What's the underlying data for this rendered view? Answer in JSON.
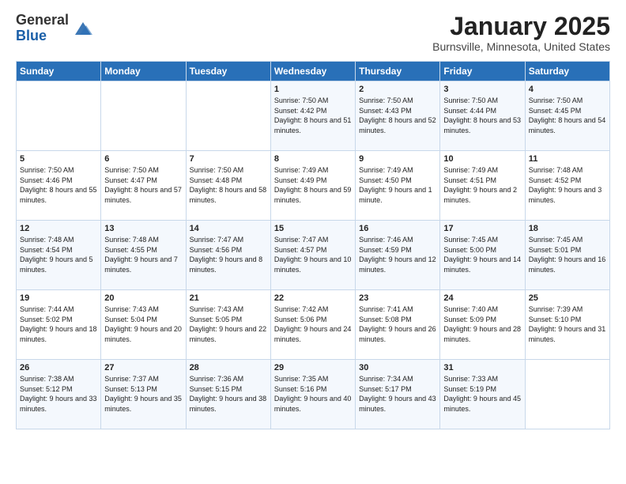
{
  "header": {
    "logo_general": "General",
    "logo_blue": "Blue",
    "month_title": "January 2025",
    "location": "Burnsville, Minnesota, United States"
  },
  "days_of_week": [
    "Sunday",
    "Monday",
    "Tuesday",
    "Wednesday",
    "Thursday",
    "Friday",
    "Saturday"
  ],
  "weeks": [
    [
      {
        "num": "",
        "sunrise": "",
        "sunset": "",
        "daylight": ""
      },
      {
        "num": "",
        "sunrise": "",
        "sunset": "",
        "daylight": ""
      },
      {
        "num": "",
        "sunrise": "",
        "sunset": "",
        "daylight": ""
      },
      {
        "num": "1",
        "sunrise": "Sunrise: 7:50 AM",
        "sunset": "Sunset: 4:42 PM",
        "daylight": "Daylight: 8 hours and 51 minutes."
      },
      {
        "num": "2",
        "sunrise": "Sunrise: 7:50 AM",
        "sunset": "Sunset: 4:43 PM",
        "daylight": "Daylight: 8 hours and 52 minutes."
      },
      {
        "num": "3",
        "sunrise": "Sunrise: 7:50 AM",
        "sunset": "Sunset: 4:44 PM",
        "daylight": "Daylight: 8 hours and 53 minutes."
      },
      {
        "num": "4",
        "sunrise": "Sunrise: 7:50 AM",
        "sunset": "Sunset: 4:45 PM",
        "daylight": "Daylight: 8 hours and 54 minutes."
      }
    ],
    [
      {
        "num": "5",
        "sunrise": "Sunrise: 7:50 AM",
        "sunset": "Sunset: 4:46 PM",
        "daylight": "Daylight: 8 hours and 55 minutes."
      },
      {
        "num": "6",
        "sunrise": "Sunrise: 7:50 AM",
        "sunset": "Sunset: 4:47 PM",
        "daylight": "Daylight: 8 hours and 57 minutes."
      },
      {
        "num": "7",
        "sunrise": "Sunrise: 7:50 AM",
        "sunset": "Sunset: 4:48 PM",
        "daylight": "Daylight: 8 hours and 58 minutes."
      },
      {
        "num": "8",
        "sunrise": "Sunrise: 7:49 AM",
        "sunset": "Sunset: 4:49 PM",
        "daylight": "Daylight: 8 hours and 59 minutes."
      },
      {
        "num": "9",
        "sunrise": "Sunrise: 7:49 AM",
        "sunset": "Sunset: 4:50 PM",
        "daylight": "Daylight: 9 hours and 1 minute."
      },
      {
        "num": "10",
        "sunrise": "Sunrise: 7:49 AM",
        "sunset": "Sunset: 4:51 PM",
        "daylight": "Daylight: 9 hours and 2 minutes."
      },
      {
        "num": "11",
        "sunrise": "Sunrise: 7:48 AM",
        "sunset": "Sunset: 4:52 PM",
        "daylight": "Daylight: 9 hours and 3 minutes."
      }
    ],
    [
      {
        "num": "12",
        "sunrise": "Sunrise: 7:48 AM",
        "sunset": "Sunset: 4:54 PM",
        "daylight": "Daylight: 9 hours and 5 minutes."
      },
      {
        "num": "13",
        "sunrise": "Sunrise: 7:48 AM",
        "sunset": "Sunset: 4:55 PM",
        "daylight": "Daylight: 9 hours and 7 minutes."
      },
      {
        "num": "14",
        "sunrise": "Sunrise: 7:47 AM",
        "sunset": "Sunset: 4:56 PM",
        "daylight": "Daylight: 9 hours and 8 minutes."
      },
      {
        "num": "15",
        "sunrise": "Sunrise: 7:47 AM",
        "sunset": "Sunset: 4:57 PM",
        "daylight": "Daylight: 9 hours and 10 minutes."
      },
      {
        "num": "16",
        "sunrise": "Sunrise: 7:46 AM",
        "sunset": "Sunset: 4:59 PM",
        "daylight": "Daylight: 9 hours and 12 minutes."
      },
      {
        "num": "17",
        "sunrise": "Sunrise: 7:45 AM",
        "sunset": "Sunset: 5:00 PM",
        "daylight": "Daylight: 9 hours and 14 minutes."
      },
      {
        "num": "18",
        "sunrise": "Sunrise: 7:45 AM",
        "sunset": "Sunset: 5:01 PM",
        "daylight": "Daylight: 9 hours and 16 minutes."
      }
    ],
    [
      {
        "num": "19",
        "sunrise": "Sunrise: 7:44 AM",
        "sunset": "Sunset: 5:02 PM",
        "daylight": "Daylight: 9 hours and 18 minutes."
      },
      {
        "num": "20",
        "sunrise": "Sunrise: 7:43 AM",
        "sunset": "Sunset: 5:04 PM",
        "daylight": "Daylight: 9 hours and 20 minutes."
      },
      {
        "num": "21",
        "sunrise": "Sunrise: 7:43 AM",
        "sunset": "Sunset: 5:05 PM",
        "daylight": "Daylight: 9 hours and 22 minutes."
      },
      {
        "num": "22",
        "sunrise": "Sunrise: 7:42 AM",
        "sunset": "Sunset: 5:06 PM",
        "daylight": "Daylight: 9 hours and 24 minutes."
      },
      {
        "num": "23",
        "sunrise": "Sunrise: 7:41 AM",
        "sunset": "Sunset: 5:08 PM",
        "daylight": "Daylight: 9 hours and 26 minutes."
      },
      {
        "num": "24",
        "sunrise": "Sunrise: 7:40 AM",
        "sunset": "Sunset: 5:09 PM",
        "daylight": "Daylight: 9 hours and 28 minutes."
      },
      {
        "num": "25",
        "sunrise": "Sunrise: 7:39 AM",
        "sunset": "Sunset: 5:10 PM",
        "daylight": "Daylight: 9 hours and 31 minutes."
      }
    ],
    [
      {
        "num": "26",
        "sunrise": "Sunrise: 7:38 AM",
        "sunset": "Sunset: 5:12 PM",
        "daylight": "Daylight: 9 hours and 33 minutes."
      },
      {
        "num": "27",
        "sunrise": "Sunrise: 7:37 AM",
        "sunset": "Sunset: 5:13 PM",
        "daylight": "Daylight: 9 hours and 35 minutes."
      },
      {
        "num": "28",
        "sunrise": "Sunrise: 7:36 AM",
        "sunset": "Sunset: 5:15 PM",
        "daylight": "Daylight: 9 hours and 38 minutes."
      },
      {
        "num": "29",
        "sunrise": "Sunrise: 7:35 AM",
        "sunset": "Sunset: 5:16 PM",
        "daylight": "Daylight: 9 hours and 40 minutes."
      },
      {
        "num": "30",
        "sunrise": "Sunrise: 7:34 AM",
        "sunset": "Sunset: 5:17 PM",
        "daylight": "Daylight: 9 hours and 43 minutes."
      },
      {
        "num": "31",
        "sunrise": "Sunrise: 7:33 AM",
        "sunset": "Sunset: 5:19 PM",
        "daylight": "Daylight: 9 hours and 45 minutes."
      },
      {
        "num": "",
        "sunrise": "",
        "sunset": "",
        "daylight": ""
      }
    ]
  ]
}
